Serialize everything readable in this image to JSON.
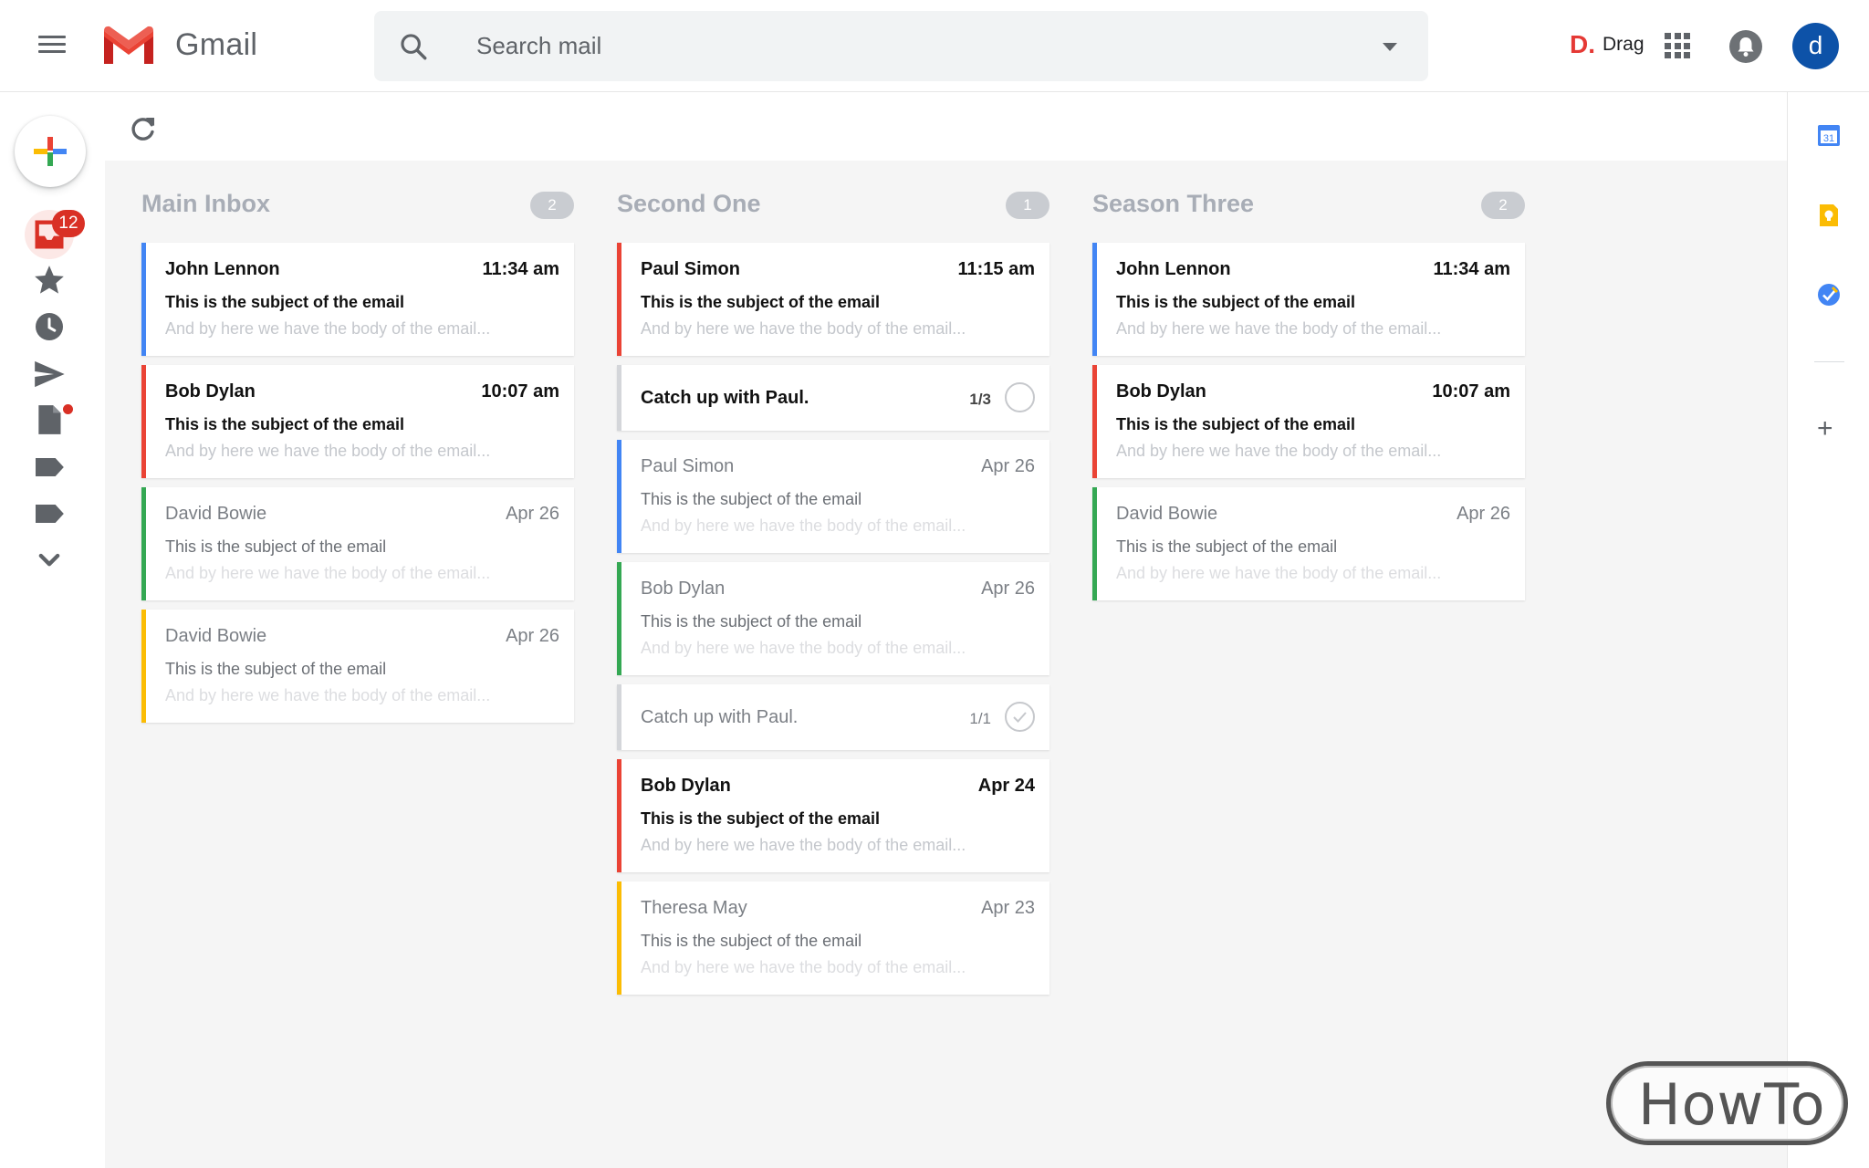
{
  "app": {
    "name": "Gmail"
  },
  "search": {
    "placeholder": "Search mail"
  },
  "header": {
    "brand_logo": "D.",
    "brand_label": "Drag",
    "avatar_initial": "d"
  },
  "nav": {
    "inbox_badge": "12"
  },
  "colors": {
    "blue": "#4285f4",
    "red": "#ea4335",
    "green": "#34a853",
    "yellow": "#fbbc04",
    "gray": "#d4d6da"
  },
  "columns": [
    {
      "title": "Main Inbox",
      "count": "2",
      "cards": [
        {
          "type": "email",
          "unread": true,
          "color": "blue",
          "sender": "John Lennon",
          "date": "11:34 am",
          "subject": "This is the subject of the email",
          "body": "And by here we have the body of the email..."
        },
        {
          "type": "email",
          "unread": true,
          "color": "red",
          "sender": "Bob Dylan",
          "date": "10:07 am",
          "subject": "This is the subject of the email",
          "body": "And by here we have the body of the email..."
        },
        {
          "type": "email",
          "unread": false,
          "color": "green",
          "sender": "David Bowie",
          "date": "Apr 26",
          "subject": "This is the subject of the email",
          "body": "And by here we have the body of the email..."
        },
        {
          "type": "email",
          "unread": false,
          "color": "yellow",
          "sender": "David Bowie",
          "date": "Apr 26",
          "subject": "This is the subject of the email",
          "body": "And by here we have the body of the email..."
        }
      ]
    },
    {
      "title": "Second One",
      "count": "1",
      "cards": [
        {
          "type": "email",
          "unread": true,
          "color": "red",
          "sender": "Paul Simon",
          "date": "11:15 am",
          "subject": "This is the subject of the email",
          "body": "And by here we have the body of the email..."
        },
        {
          "type": "task",
          "done": false,
          "title": "Catch up with Paul.",
          "progress": "1/3"
        },
        {
          "type": "email",
          "unread": false,
          "color": "blue",
          "sender": "Paul Simon",
          "date": "Apr 26",
          "subject": "This is the subject of the email",
          "body": "And by here we have the body of the email..."
        },
        {
          "type": "email",
          "unread": false,
          "color": "green",
          "sender": "Bob Dylan",
          "date": "Apr 26",
          "subject": "This is the subject of the email",
          "body": "And by here we have the body of the email..."
        },
        {
          "type": "task",
          "done": true,
          "title": "Catch up with Paul.",
          "progress": "1/1"
        },
        {
          "type": "email",
          "unread": true,
          "color": "red",
          "sender": "Bob Dylan",
          "date": "Apr 24",
          "subject": "This is the subject of the email",
          "body": "And by here we have the body of the email..."
        },
        {
          "type": "email",
          "unread": false,
          "color": "yellow",
          "sender": "Theresa May",
          "date": "Apr 23",
          "subject": "This is the subject of the email",
          "body": "And by here we have the body of the email..."
        }
      ]
    },
    {
      "title": "Season Three",
      "count": "2",
      "cards": [
        {
          "type": "email",
          "unread": true,
          "color": "blue",
          "sender": "John Lennon",
          "date": "11:34 am",
          "subject": "This is the subject of the email",
          "body": "And by here we have the body of the email..."
        },
        {
          "type": "email",
          "unread": true,
          "color": "red",
          "sender": "Bob Dylan",
          "date": "10:07 am",
          "subject": "This is the subject of the email",
          "body": "And by here we have the body of the email..."
        },
        {
          "type": "email",
          "unread": false,
          "color": "green",
          "sender": "David Bowie",
          "date": "Apr 26",
          "subject": "This is the subject of the email",
          "body": "And by here we have the body of the email..."
        }
      ]
    }
  ],
  "side_panel": {
    "calendar_day": "31"
  },
  "watermark": "HowTo"
}
